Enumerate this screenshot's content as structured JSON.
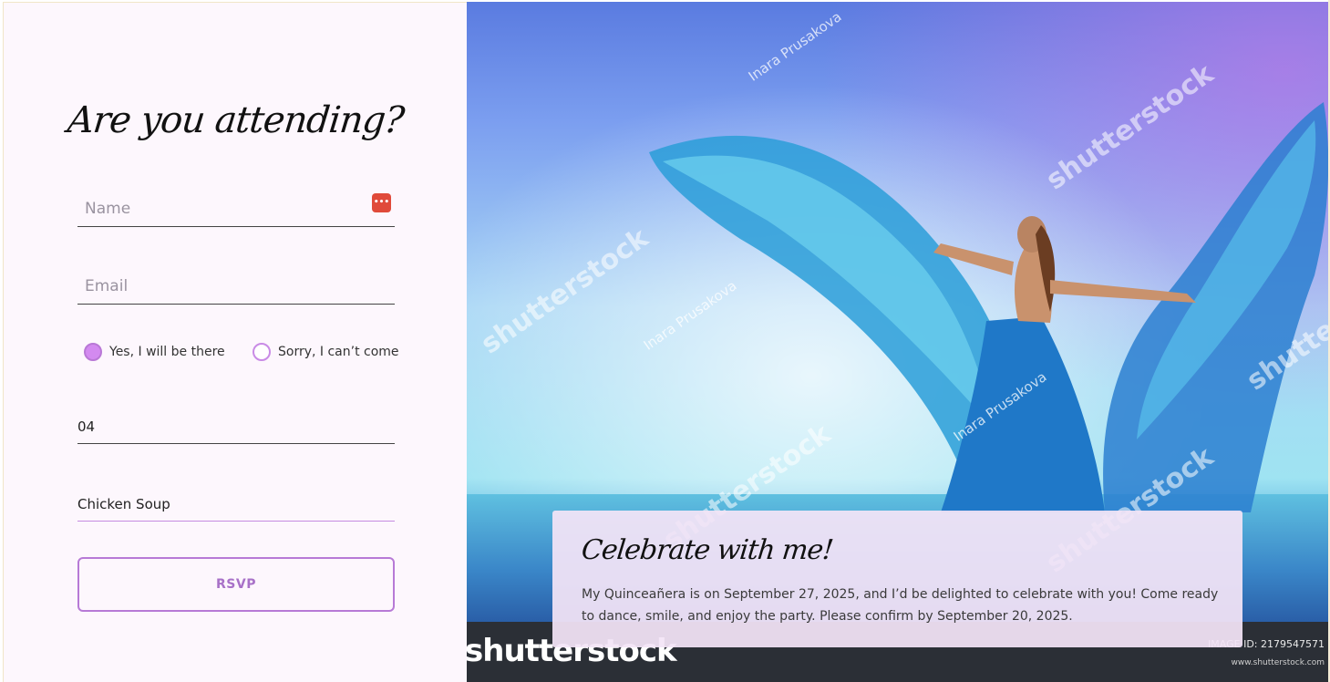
{
  "form": {
    "title": "Are you attending?",
    "name_placeholder": "Name",
    "email_placeholder": "Email",
    "attend_yes": "Yes, I will be there",
    "attend_no": "Sorry, I can’t come",
    "attend_selected": "yes",
    "guests_value": "04",
    "meal_value": "Chicken Soup",
    "submit_label": "RSVP",
    "password_manager_icon": "password-manager-icon"
  },
  "card": {
    "title": "Celebrate with me!",
    "body": "My Quinceañera is on September 27, 2025, and I’d be delighted to celebrate with you! Come ready to dance, smile, and enjoy the party. Please confirm by September 20, 2025."
  },
  "stock": {
    "logo": "shutterstock",
    "watermark": "shutterstock",
    "author": "Inara Prusakova",
    "image_id": "IMAGE ID: 2179547571",
    "site": "www.shutterstock.com"
  },
  "colors": {
    "accent": "#b77ad6",
    "radio_checked": "#d38af0",
    "panel_bg": "#fdf7fd"
  }
}
